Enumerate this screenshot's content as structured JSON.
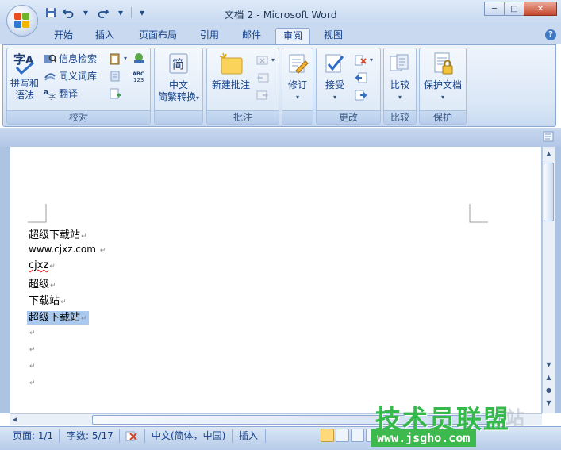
{
  "window": {
    "title": "文档 2 - Microsoft Word",
    "minimize": "─",
    "maximize": "□",
    "close": "✕"
  },
  "quick_access": {
    "save_icon": "floppy-icon",
    "undo_icon": "undo-icon",
    "redo_icon": "redo-icon",
    "more": "▾"
  },
  "tabs": [
    {
      "label": "开始"
    },
    {
      "label": "插入"
    },
    {
      "label": "页面布局"
    },
    {
      "label": "引用"
    },
    {
      "label": "邮件"
    },
    {
      "label": "审阅",
      "active": true
    },
    {
      "label": "视图"
    }
  ],
  "help": "?",
  "ribbon": {
    "proofing": {
      "label": "校对",
      "spelling_line1": "拼写和",
      "spelling_line2": "语法",
      "research": "信息检索",
      "thesaurus": "同义词库",
      "translate": "翻译"
    },
    "chinese": {
      "convert_line1": "中文",
      "convert_line2": "简繁转换",
      "icon_char": "简"
    },
    "comments": {
      "label": "批注",
      "new_comment": "新建批注"
    },
    "tracking": {
      "label": "修订",
      "track_changes": "修订"
    },
    "changes": {
      "label": "更改",
      "accept": "接受"
    },
    "compare": {
      "label": "比较",
      "compare": "比较"
    },
    "protect": {
      "label": "保护",
      "protect_document": "保护文档"
    },
    "accent_color": "#15428b"
  },
  "document": {
    "lines": [
      {
        "text": "超级下载站",
        "mark": "↵"
      },
      {
        "text": "www.cjxz.com ",
        "mark": "↵"
      },
      {
        "text": "cjxz",
        "mark": "↵"
      },
      {
        "text": "超级",
        "mark": "↵"
      },
      {
        "text": "下载站",
        "mark": "↵"
      },
      {
        "text": "超级下载站",
        "mark": "↵",
        "selected": true
      },
      {
        "text": "",
        "mark": "↵"
      },
      {
        "text": "",
        "mark": "↵"
      },
      {
        "text": "",
        "mark": "↵"
      },
      {
        "text": "",
        "mark": "↵"
      }
    ]
  },
  "statusbar": {
    "page": "页面: 1/1",
    "words": "字数: 5/17",
    "language": "中文(简体，中国)",
    "insert_mode": "插入"
  },
  "watermark": {
    "brand": "技术员联盟",
    "url": "www.jsgho.com",
    "ghost": "站"
  }
}
